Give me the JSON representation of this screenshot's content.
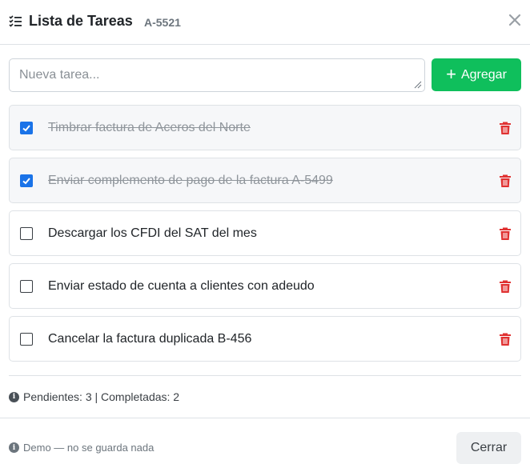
{
  "header": {
    "title": "Lista de Tareas",
    "code": "A-5521",
    "icons": {
      "list": "list-check-icon",
      "close": "close-icon"
    }
  },
  "form": {
    "placeholder": "Nueva tarea...",
    "value": "",
    "add_label": "Agregar",
    "add_icon": "plus-icon",
    "add_color": "#0fbf5c"
  },
  "tasks": [
    {
      "label": "Timbrar factura de Aceros del Norte",
      "done": true
    },
    {
      "label": "Enviar complemento de pago de la factura A-5499",
      "done": true
    },
    {
      "label": "Descargar los CFDI del SAT del mes",
      "done": false
    },
    {
      "label": "Enviar estado de cuenta a clientes con adeudo",
      "done": false
    },
    {
      "label": "Cancelar la factura duplicada B-456",
      "done": false
    }
  ],
  "summary": {
    "text": "Pendientes: 3 | Completadas: 2",
    "pending": 3,
    "completed": 2
  },
  "footer": {
    "note": "Demo — no se guarda nada",
    "close_label": "Cerrar"
  },
  "colors": {
    "check_accent": "#1a73e8",
    "delete": "#e03131",
    "add_button": "#0fbf5c"
  }
}
